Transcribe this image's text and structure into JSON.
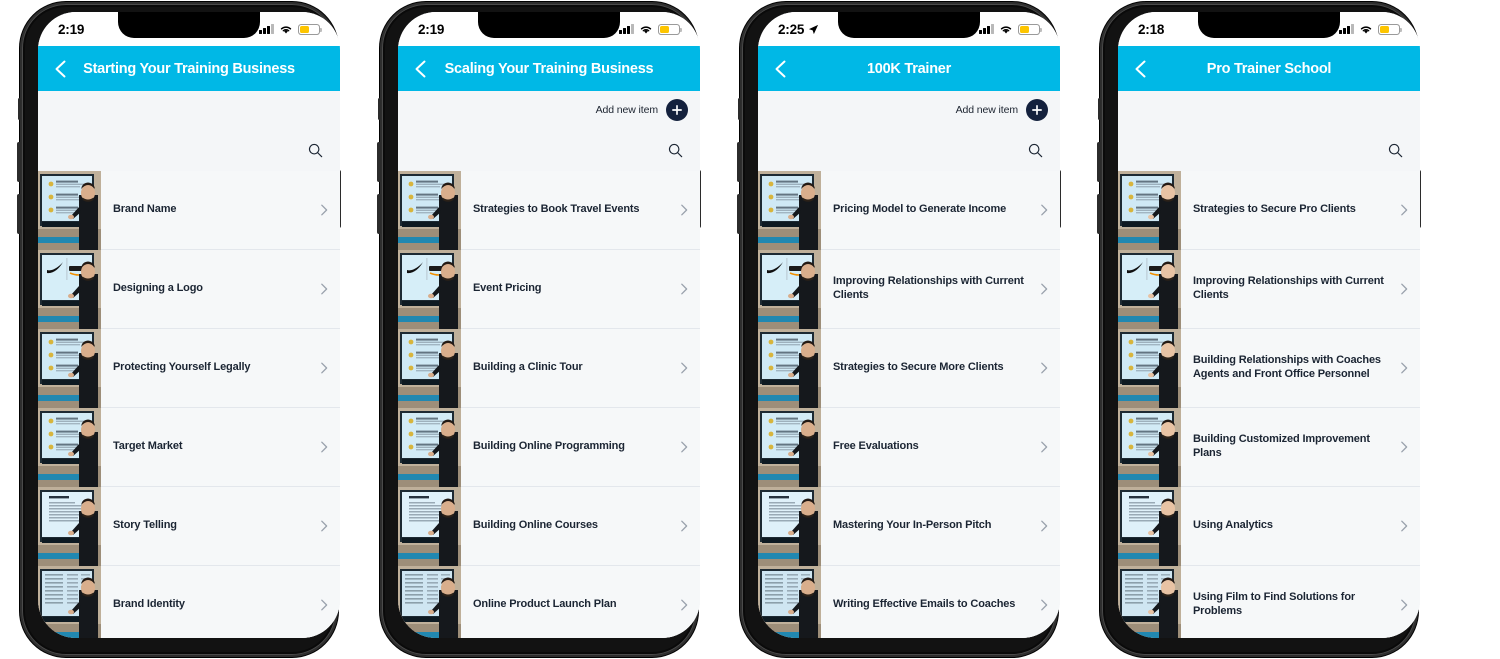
{
  "app": {
    "accent_color": "#00b8e6",
    "screen_bg": "#f4f6f8",
    "row_bg": "#f6f8f9",
    "add_button_color": "#14213d",
    "battery_color": "#fdc500",
    "title_text_color": "#1b2533"
  },
  "icons": {
    "back": "chevron-left-icon",
    "search": "search-icon",
    "add": "plus-icon",
    "chevron": "chevron-right-icon",
    "signal": "cellular-signal-icon",
    "wifi": "wifi-icon",
    "battery": "battery-low-power-icon",
    "location": "location-arrow-icon"
  },
  "phones": [
    {
      "status": {
        "time": "2:19",
        "location_arrow": false
      },
      "nav": {
        "title": "Starting Your Training Business",
        "back_label": "Back"
      },
      "toolbar": {
        "show_add": false,
        "add_label": "Add new item",
        "search_label": "Search"
      },
      "items": [
        {
          "title": "Brand Name"
        },
        {
          "title": "Designing a Logo"
        },
        {
          "title": "Protecting Yourself Legally"
        },
        {
          "title": "Target Market"
        },
        {
          "title": "Story Telling"
        },
        {
          "title": "Brand Identity"
        }
      ]
    },
    {
      "status": {
        "time": "2:19",
        "location_arrow": false
      },
      "nav": {
        "title": "Scaling Your Training Business",
        "back_label": "Back"
      },
      "toolbar": {
        "show_add": true,
        "add_label": "Add new item",
        "search_label": "Search"
      },
      "items": [
        {
          "title": "Strategies to Book Travel Events"
        },
        {
          "title": "Event Pricing"
        },
        {
          "title": "Building a Clinic Tour"
        },
        {
          "title": "Building Online Programming"
        },
        {
          "title": "Building Online Courses"
        },
        {
          "title": "Online Product Launch Plan"
        }
      ]
    },
    {
      "status": {
        "time": "2:25",
        "location_arrow": true
      },
      "nav": {
        "title": "100K Trainer",
        "back_label": "Back"
      },
      "toolbar": {
        "show_add": true,
        "add_label": "Add new item",
        "search_label": "Search"
      },
      "items": [
        {
          "title": "Pricing Model to Generate Income"
        },
        {
          "title": "Improving Relationships with Current Clients"
        },
        {
          "title": "Strategies to Secure More Clients"
        },
        {
          "title": "Free Evaluations"
        },
        {
          "title": "Mastering Your In-Person Pitch"
        },
        {
          "title": "Writing Effective Emails to Coaches"
        }
      ]
    },
    {
      "status": {
        "time": "2:18",
        "location_arrow": false
      },
      "nav": {
        "title": "Pro Trainer School",
        "back_label": "Back"
      },
      "toolbar": {
        "show_add": false,
        "add_label": "Add new item",
        "search_label": "Search"
      },
      "items": [
        {
          "title": "Strategies to Secure Pro Clients"
        },
        {
          "title": "Improving Relationships with Current Clients"
        },
        {
          "title": "Building Relationships with Coaches Agents and Front Office Personnel"
        },
        {
          "title": "Building Customized Improvement Plans"
        },
        {
          "title": "Using Analytics"
        },
        {
          "title": "Using Film to Find Solutions for Problems"
        }
      ]
    }
  ]
}
